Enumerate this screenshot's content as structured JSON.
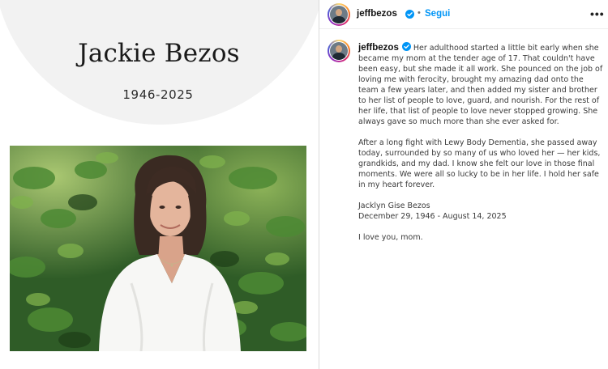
{
  "memorial": {
    "name": "Jackie Bezos",
    "years": "1946-2025"
  },
  "post": {
    "username": "jeffbezos",
    "verified_icon": "verified-badge-icon",
    "separator": "•",
    "follow_label": "Segui",
    "more_icon": "•••",
    "caption": {
      "paragraph_1": "Her adulthood started a little bit early when she became my mom at the tender age of 17. That couldn't have been easy, but she made it all work. She pounced on the job of loving me with ferocity, brought my amazing dad onto the team a few years later, and then added my sister and brother to her list of people to love, guard, and nourish. For the rest of her life, that list of people to love never stopped growing. She always gave so much more than she ever asked for.",
      "paragraph_2": "After a long fight with Lewy Body Dementia, she passed away today, surrounded by so many of us who loved her — her kids, grandkids, and my dad. I know she felt our love in those final moments. We were all so lucky to be in her life. I hold her safe in my heart forever.",
      "signature_name": "Jacklyn Gise Bezos",
      "signature_dates": "December 29, 1946 - August 14, 2025",
      "closing": "I love you, mom."
    }
  },
  "colors": {
    "link_blue": "#0095f6",
    "verified_blue": "#0095f6",
    "arc_gray": "#f2f2f2"
  }
}
